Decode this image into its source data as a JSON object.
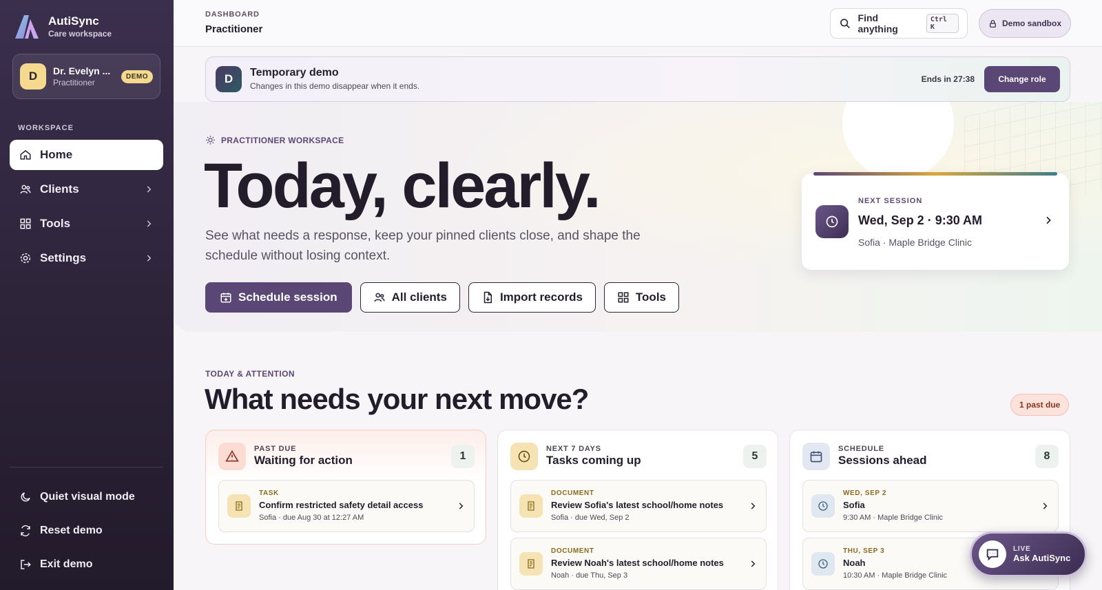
{
  "brand": {
    "name": "AutiSync",
    "subtitle": "Care workspace"
  },
  "user": {
    "initial": "D",
    "name": "Dr. Evelyn ...",
    "role": "Practitioner",
    "badge": "DEMO"
  },
  "sidebar": {
    "section_label": "WORKSPACE",
    "items": [
      {
        "label": "Home",
        "icon": "home-icon",
        "active": true
      },
      {
        "label": "Clients",
        "icon": "users-icon"
      },
      {
        "label": "Tools",
        "icon": "grid-icon"
      },
      {
        "label": "Settings",
        "icon": "gear-icon"
      }
    ],
    "bottom": [
      {
        "label": "Quiet visual mode",
        "icon": "moon-icon"
      },
      {
        "label": "Reset demo",
        "icon": "refresh-icon"
      },
      {
        "label": "Exit demo",
        "icon": "exit-icon"
      }
    ]
  },
  "header": {
    "breadcrumb": "DASHBOARD",
    "title": "Practitioner",
    "search_label": "Find anything",
    "search_shortcut": "Ctrl K",
    "sandbox_label": "Demo sandbox"
  },
  "banner": {
    "initial": "D",
    "title": "Temporary demo",
    "subtitle": "Changes in this demo disappear when it ends.",
    "ends": "Ends in 27:38",
    "change_role": "Change role"
  },
  "hero": {
    "eyebrow": "PRACTITIONER WORKSPACE",
    "title": "Today, clearly.",
    "subtitle": "See what needs a response, keep your pinned clients close, and shape the schedule without losing context.",
    "actions": {
      "schedule": "Schedule session",
      "clients": "All clients",
      "import": "Import records",
      "tools": "Tools"
    },
    "next_session": {
      "label": "NEXT SESSION",
      "when": "Wed, Sep 2 · 9:30 AM",
      "where": "Sofia · Maple Bridge Clinic"
    }
  },
  "attention": {
    "eyebrow": "TODAY & ATTENTION",
    "title": "What needs your next move?",
    "past_due_pill": "1 past due",
    "columns": [
      {
        "eyebrow": "PAST DUE",
        "title": "Waiting for action",
        "count": "1",
        "items": [
          {
            "kind": "TASK",
            "title": "Confirm restricted safety detail access",
            "meta": "Sofia · due Aug 30 at 12:27 AM"
          }
        ]
      },
      {
        "eyebrow": "NEXT 7 DAYS",
        "title": "Tasks coming up",
        "count": "5",
        "items": [
          {
            "kind": "DOCUMENT",
            "title": "Review Sofia's latest school/home notes",
            "meta": "Sofia · due Wed, Sep 2"
          },
          {
            "kind": "DOCUMENT",
            "title": "Review Noah's latest school/home notes",
            "meta": "Noah · due Thu, Sep 3"
          }
        ]
      },
      {
        "eyebrow": "SCHEDULE",
        "title": "Sessions ahead",
        "count": "8",
        "items": [
          {
            "kind": "WED, SEP 2",
            "title": "Sofia",
            "meta": "9:30 AM · Maple Bridge Clinic"
          },
          {
            "kind": "THU, SEP 3",
            "title": "Noah",
            "meta": "10:30 AM · Maple Bridge Clinic"
          }
        ]
      }
    ]
  },
  "assistant": {
    "status": "LIVE",
    "label": "Ask AutiSync"
  },
  "colors": {
    "accent": "#5b4776",
    "sidebar": "#2c2338",
    "warning": "#8c3423",
    "gold": "#f5d98f"
  }
}
